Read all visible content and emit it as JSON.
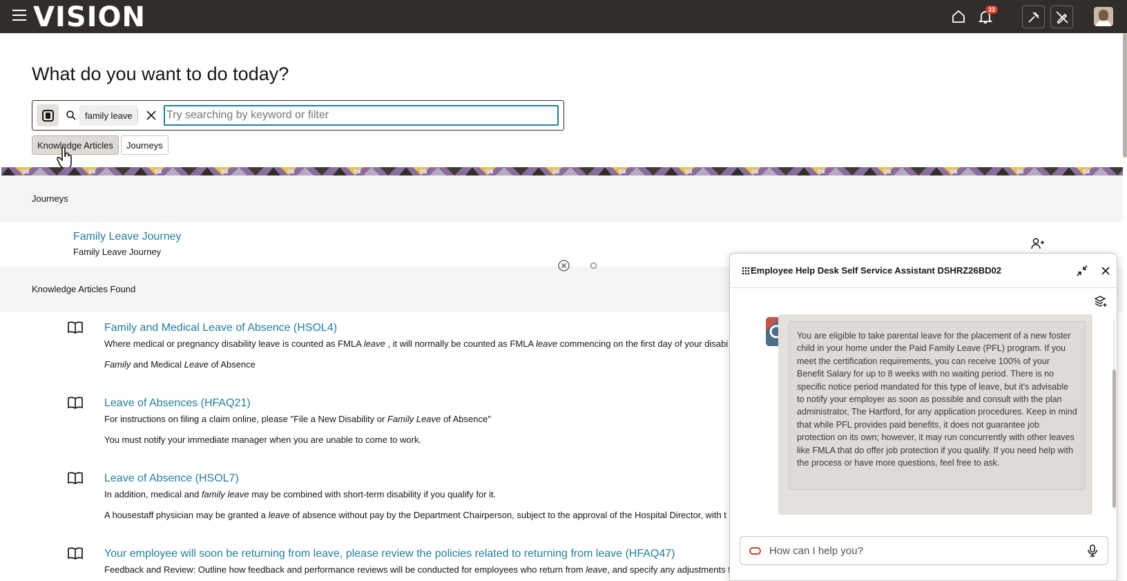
{
  "app": {
    "logo": "VISION",
    "notification_count": "33"
  },
  "page": {
    "heading": "What do you want to do today?"
  },
  "search": {
    "chip_label": "family leave",
    "placeholder": "Try searching by keyword or filter",
    "value": ""
  },
  "filters": [
    {
      "label": "Knowledge Articles",
      "active": true
    },
    {
      "label": "Journeys",
      "active": false
    }
  ],
  "journeys": {
    "section_label": "Journeys",
    "items": [
      {
        "title": "Family Leave Journey",
        "subtitle": "Family Leave Journey"
      }
    ]
  },
  "articles": {
    "section_label": "Knowledge Articles Found",
    "items": [
      {
        "title": "Family and Medical Leave of Absence (HSOL4)",
        "line1": "Where medical or pregnancy disability leave is counted as FMLA <i>leave</i> , it will normally be counted as FMLA <i>leave</i> commencing on the first day of your disabi",
        "line2": "<i>Family</i> and Medical <i>Leave</i> of Absence"
      },
      {
        "title": "Leave of Absences (HFAQ21)",
        "line1": "For instructions on filing a claim online, please \"File a New Disability or <i>Family Leave</i> of Absence\"",
        "line2": "You must notify your immediate manager when you are unable to come to work."
      },
      {
        "title": "Leave of Absence (HSOL7)",
        "line1": "In addition, medical and <i>family leave</i> may be combined with short-term disability if you qualify for it.",
        "line2": "A housestaff physician may be granted a <i>leave</i> of absence without pay by the Department Chairperson, subject to the approval of the Hospital Director, with t"
      },
      {
        "title": "Your employee will soon be returning from leave, please review the policies related to returning from leave (HFAQ47)",
        "line1": "Feedback and Review: Outline how feedback and performance reviews will be conducted for employees who return from <i>leave</i>, and specify any adjustments t",
        "line2": ""
      }
    ]
  },
  "assistant": {
    "title": "Employee Help Desk Self Service Assistant DSHRZ26BD02",
    "message": "You are eligible to take parental leave for the placement of a new foster child in your home under the Paid Family Leave (PFL) program. If you meet the certification requirements, you can receive 100% of your Benefit Salary for up to 8 weeks with no waiting period. There is no specific notice period mandated for this type of leave, but it's advisable to notify your employer as soon as possible and consult with the plan administrator, The Hartford, for any application procedures. Keep in mind that while PFL provides paid benefits, it does not guarantee job protection on its own; however, it may run concurrently with other leaves like FMLA that do offer job protection if you qualify. If you need help with the process or have more questions, feel free to ask.",
    "input_placeholder": "How can I help you?",
    "input_value": ""
  },
  "colors": {
    "topbar": "#312d2a",
    "link": "#227e9e",
    "badge": "#d63b25",
    "oracle_red": "#c74634"
  },
  "icons": [
    "hamburger-icon",
    "home-icon",
    "bell-icon",
    "tools-icon",
    "edit-off-icon",
    "search-icon",
    "close-icon",
    "book-icon",
    "add-person-icon",
    "grip-icon",
    "collapse-icon",
    "layers-icon",
    "mic-icon",
    "oracle-logo-icon"
  ]
}
